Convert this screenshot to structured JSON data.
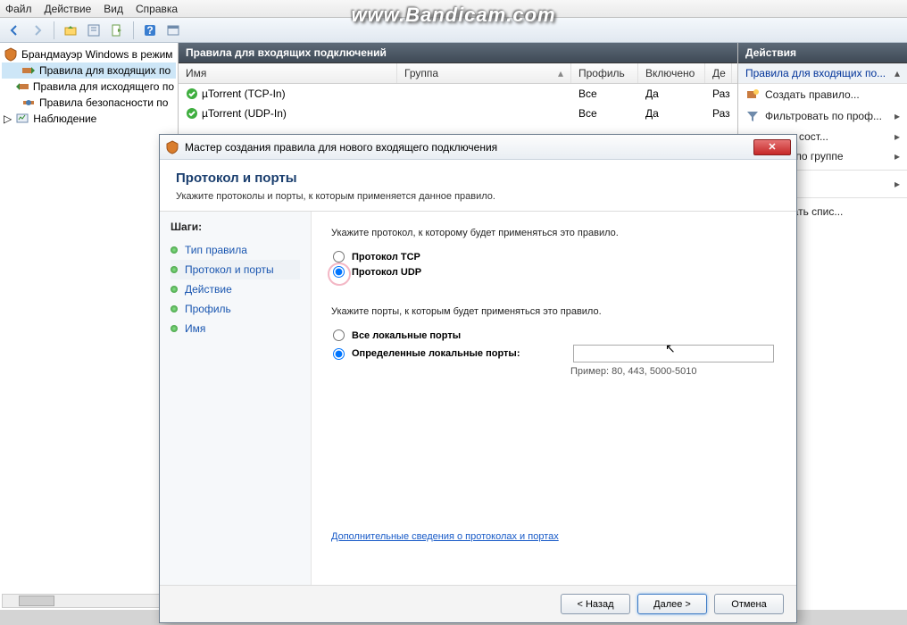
{
  "watermark": "www.Bandicam.com",
  "menu": {
    "file": "Файл",
    "action": "Действие",
    "view": "Вид",
    "help": "Справка"
  },
  "tree": {
    "root": "Брандмауэр Windows в режим",
    "inbound": "Правила для входящих по",
    "outbound": "Правила для исходящего по",
    "security": "Правила безопасности по",
    "monitoring": "Наблюдение"
  },
  "center": {
    "title": "Правила для входящих подключений",
    "cols": {
      "name": "Имя",
      "group": "Группа",
      "profile": "Профиль",
      "enabled": "Включено",
      "action": "Де"
    },
    "rows": [
      {
        "name": "µTorrent (TCP-In)",
        "group": "",
        "profile": "Все",
        "enabled": "Да",
        "action": "Раз"
      },
      {
        "name": "µTorrent (UDP-In)",
        "group": "",
        "profile": "Все",
        "enabled": "Да",
        "action": "Раз"
      }
    ]
  },
  "actions": {
    "header": "Действия",
    "groupTitle": "Правила для входящих по...",
    "items": {
      "newRule": "Создать правило...",
      "filterProfile": "Фильтровать по проф...",
      "filterState": "ать по сост...",
      "filterGroup": "овать по группе",
      "exportList": "гировать спис..."
    }
  },
  "wizard": {
    "title": "Мастер создания правила для нового входящего подключения",
    "heading": "Протокол и порты",
    "subtitle": "Укажите протоколы и порты, к которым применяется данное правило.",
    "stepsLabel": "Шаги:",
    "steps": {
      "ruleType": "Тип правила",
      "protoPorts": "Протокол и порты",
      "action": "Действие",
      "profile": "Профиль",
      "name": "Имя"
    },
    "q1": "Укажите протокол, к которому будет применяться это правило.",
    "tcp": "Протокол TCP",
    "udp": "Протокол UDP",
    "q2": "Укажите порты, к которым будет применяться это правило.",
    "allPorts": "Все локальные порты",
    "specificPorts": "Определенные локальные порты:",
    "portValue": "",
    "example": "Пример: 80, 443, 5000-5010",
    "moreInfo": "Дополнительные сведения о протоколах и портах",
    "back": "< Назад",
    "next": "Далее >",
    "cancel": "Отмена"
  }
}
